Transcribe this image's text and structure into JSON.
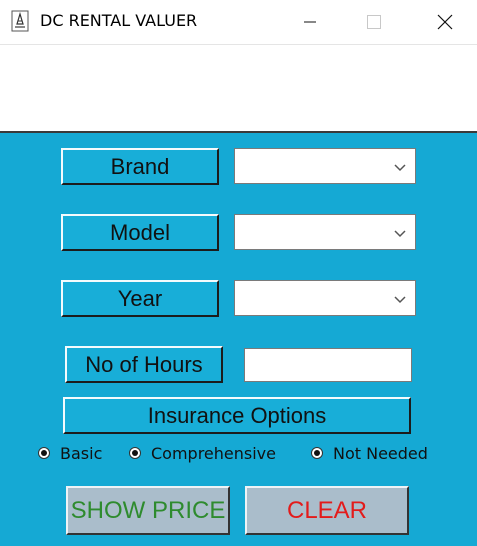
{
  "window": {
    "title": "DC RENTAL VALUER",
    "icon": "app-document-icon",
    "controls": [
      "minimize-icon",
      "maximize-icon",
      "close-icon"
    ]
  },
  "form": {
    "brand_label": "Brand",
    "brand_value": "",
    "model_label": "Model",
    "model_value": "",
    "year_label": "Year",
    "year_value": "",
    "hours_label": "No of Hours",
    "hours_value": "",
    "insurance_label": "Insurance Options",
    "insurance_options": [
      {
        "label": "Basic",
        "selected": true
      },
      {
        "label": "Comprehensive",
        "selected": true
      },
      {
        "label": "Not Needed",
        "selected": true
      }
    ]
  },
  "actions": {
    "show_price_label": "SHOW PRICE",
    "clear_label": "CLEAR"
  },
  "colors": {
    "panel_background": "#15a9d4",
    "label_button": "#18aed8",
    "action_button": "#aabdcb",
    "show_price_text": "#2e8b2e",
    "clear_text": "#e31b1b"
  }
}
